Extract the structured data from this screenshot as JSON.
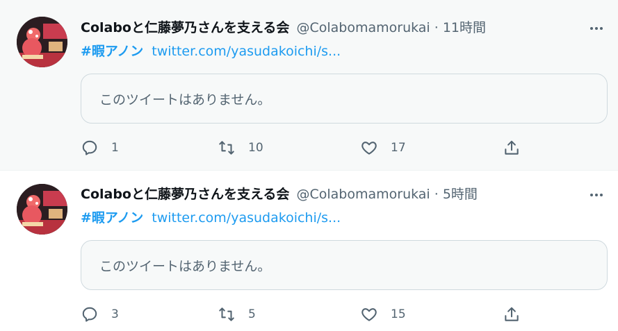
{
  "tweets": [
    {
      "display_name": "Colaboと仁藤夢乃さんを支える会",
      "handle": "@Colabomamorukai",
      "separator": "·",
      "time": "11時間",
      "hashtag": "#暇アノン",
      "link": "twitter.com/yasudakoichi/s...",
      "quote_text": "このツイートはありません。",
      "replies": "1",
      "retweets": "10",
      "likes": "17"
    },
    {
      "display_name": "Colaboと仁藤夢乃さんを支える会",
      "handle": "@Colabomamorukai",
      "separator": "·",
      "time": "5時間",
      "hashtag": "#暇アノン",
      "link": "twitter.com/yasudakoichi/s...",
      "quote_text": "このツイートはありません。",
      "replies": "3",
      "retweets": "5",
      "likes": "15"
    }
  ],
  "colors": {
    "accent": "#1d9bf0",
    "secondary_text": "#536471",
    "primary_text": "#0f1419",
    "hover_background": "#f7f9f9"
  },
  "icons": {
    "more": "more-horizontal-icon",
    "reply": "reply-icon",
    "retweet": "retweet-icon",
    "like": "heart-icon",
    "share": "share-icon"
  }
}
